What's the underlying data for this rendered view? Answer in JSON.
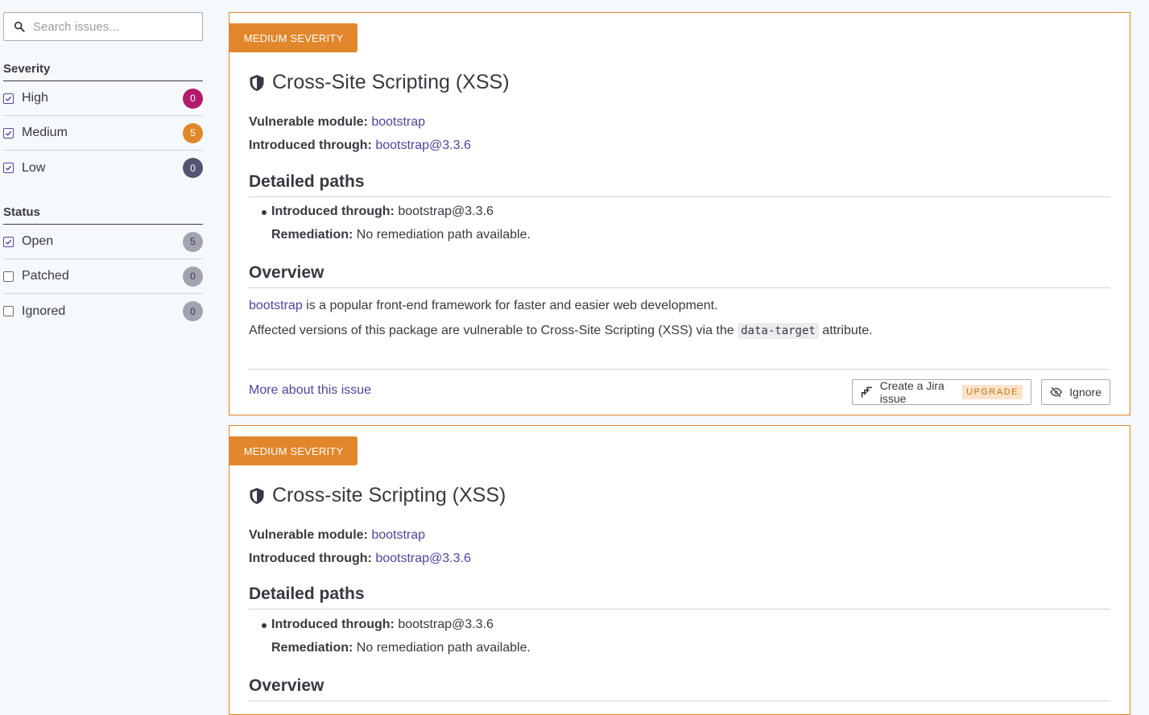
{
  "sidebar": {
    "search": {
      "placeholder": "Search issues..."
    },
    "severity_title": "Severity",
    "severity": [
      {
        "label": "High",
        "count": "0",
        "color": "#b31b6b",
        "checked": true
      },
      {
        "label": "Medium",
        "count": "5",
        "color": "#e1862a",
        "checked": true
      },
      {
        "label": "Low",
        "count": "0",
        "color": "#555473",
        "checked": true
      }
    ],
    "status_title": "Status",
    "status": [
      {
        "label": "Open",
        "count": "5",
        "color": "#a3a3b0",
        "checked": true
      },
      {
        "label": "Patched",
        "count": "0",
        "color": "#a3a3b0",
        "checked": false
      },
      {
        "label": "Ignored",
        "count": "0",
        "color": "#a3a3b0",
        "checked": false
      }
    ]
  },
  "issues": [
    {
      "severity_label": "MEDIUM SEVERITY",
      "title": "Cross-Site Scripting (XSS)",
      "vulnerable_module_label": "Vulnerable module:",
      "vulnerable_module": "bootstrap",
      "introduced_through_label": "Introduced through:",
      "introduced_through": "bootstrap@3.3.6",
      "detailed_paths_heading": "Detailed paths",
      "path_introduced_label": "Introduced through:",
      "path_introduced": "bootstrap@3.3.6",
      "remediation_label": "Remediation:",
      "remediation": "No remediation path available.",
      "overview_heading": "Overview",
      "overview_link": "bootstrap",
      "overview_text": "is a popular front-end framework for faster and easier web development.",
      "affected_pre": "Affected versions of this package are vulnerable to Cross-Site Scripting (XSS) via the",
      "affected_code": "data-target",
      "affected_post": "attribute.",
      "more_link": "More about this issue",
      "jira_button": "Create a Jira issue",
      "upgrade_badge": "UPGRADE",
      "ignore_button": "Ignore"
    },
    {
      "severity_label": "MEDIUM SEVERITY",
      "title": "Cross-site Scripting (XSS)",
      "vulnerable_module_label": "Vulnerable module:",
      "vulnerable_module": "bootstrap",
      "introduced_through_label": "Introduced through:",
      "introduced_through": "bootstrap@3.3.6",
      "detailed_paths_heading": "Detailed paths",
      "path_introduced_label": "Introduced through:",
      "path_introduced": "bootstrap@3.3.6",
      "remediation_label": "Remediation:",
      "remediation": "No remediation path available.",
      "overview_heading": "Overview"
    }
  ]
}
